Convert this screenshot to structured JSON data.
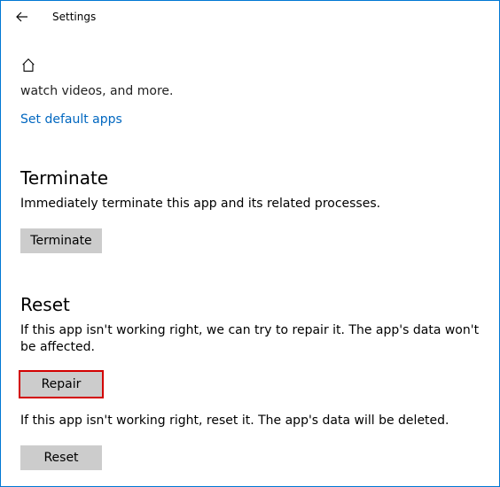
{
  "titlebar": {
    "title": "Settings"
  },
  "truncated_text": "watch videos, and more.",
  "link_text": "Set default apps",
  "terminate": {
    "heading": "Terminate",
    "desc": "Immediately terminate this app and its related processes.",
    "button": "Terminate"
  },
  "reset": {
    "heading": "Reset",
    "repair_desc": "If this app isn't working right, we can try to repair it. The app's data won't be affected.",
    "repair_button": "Repair",
    "reset_desc": "If this app isn't working right, reset it. The app's data will be deleted.",
    "reset_button": "Reset"
  }
}
